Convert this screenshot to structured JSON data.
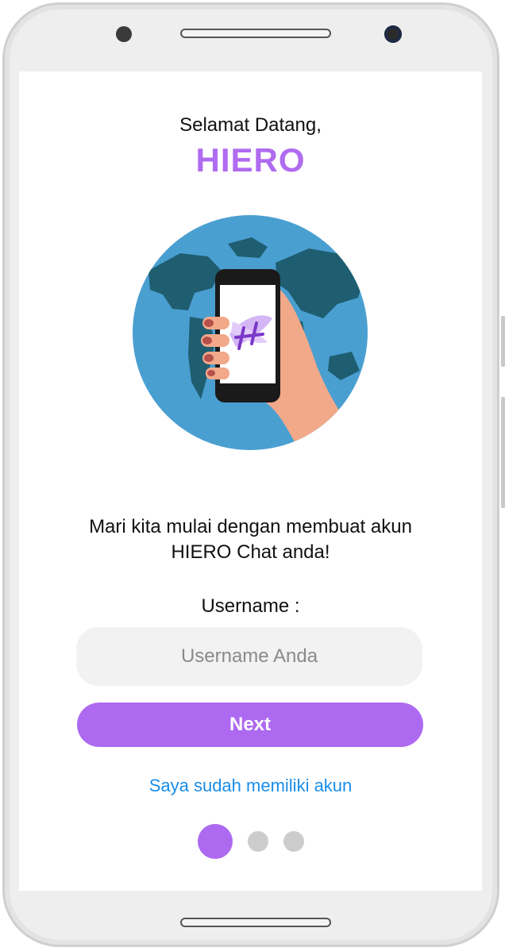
{
  "onboarding": {
    "greeting": "Selamat Datang,",
    "brand": "HIERO",
    "intro_line1": "Mari kita mulai dengan membuat akun",
    "intro_line2": "HIERO Chat anda!",
    "username_label": "Username :",
    "username_placeholder": "Username Anda",
    "username_value": "",
    "next_label": "Next",
    "login_link": "Saya sudah memiliki akun",
    "pager": {
      "current": 1,
      "total": 3
    }
  },
  "colors": {
    "accent": "#ad6af0",
    "brand_text": "#b06cf0",
    "link": "#1a8de9",
    "input_bg": "#f2f2f2",
    "inactive_dot": "#cccccc",
    "globe_ocean": "#4a9fd1",
    "globe_land": "#1f5d70",
    "hand": "#f1a98a"
  },
  "icons": {
    "illustration": "globe-phone-hand-illustration",
    "app_logo": "hiero-h-logo-icon"
  }
}
